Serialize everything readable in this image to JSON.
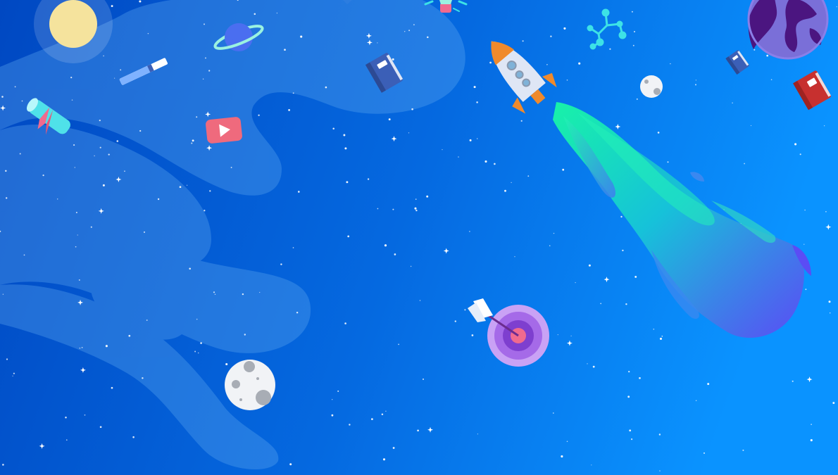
{
  "scene": {
    "title": "",
    "colors": {
      "sky_left": "#0048c2",
      "sky_right": "#0a93ff",
      "nebula": "#5fa8f0",
      "flame_start": "#18f2a8",
      "flame_end": "#5b4cf5",
      "target_outer": "#c9a2f5",
      "target_mid": "#9a55de",
      "target_core": "#f06a8e",
      "planet_ring_body": "#4a6ef0",
      "earth_land": "#4b1580",
      "earth_ocean": "#7a6fd8",
      "book_red": "#c7302f",
      "book_blue": "#3b5fb7",
      "play_button": "#ef6a7d",
      "diploma": "#4fe1e9",
      "molecule": "#3de2e6"
    },
    "icons": [
      "sun-icon",
      "ringed-planet-icon",
      "pencil-icon",
      "diploma-scroll-icon",
      "play-button-icon",
      "book-icon",
      "lightbulb-icon",
      "rocket-icon",
      "molecule-icon",
      "small-moon-icon",
      "earth-icon",
      "red-book-icon",
      "blue-book-icon",
      "target-icon",
      "arrow-icon",
      "moon-icon"
    ]
  }
}
